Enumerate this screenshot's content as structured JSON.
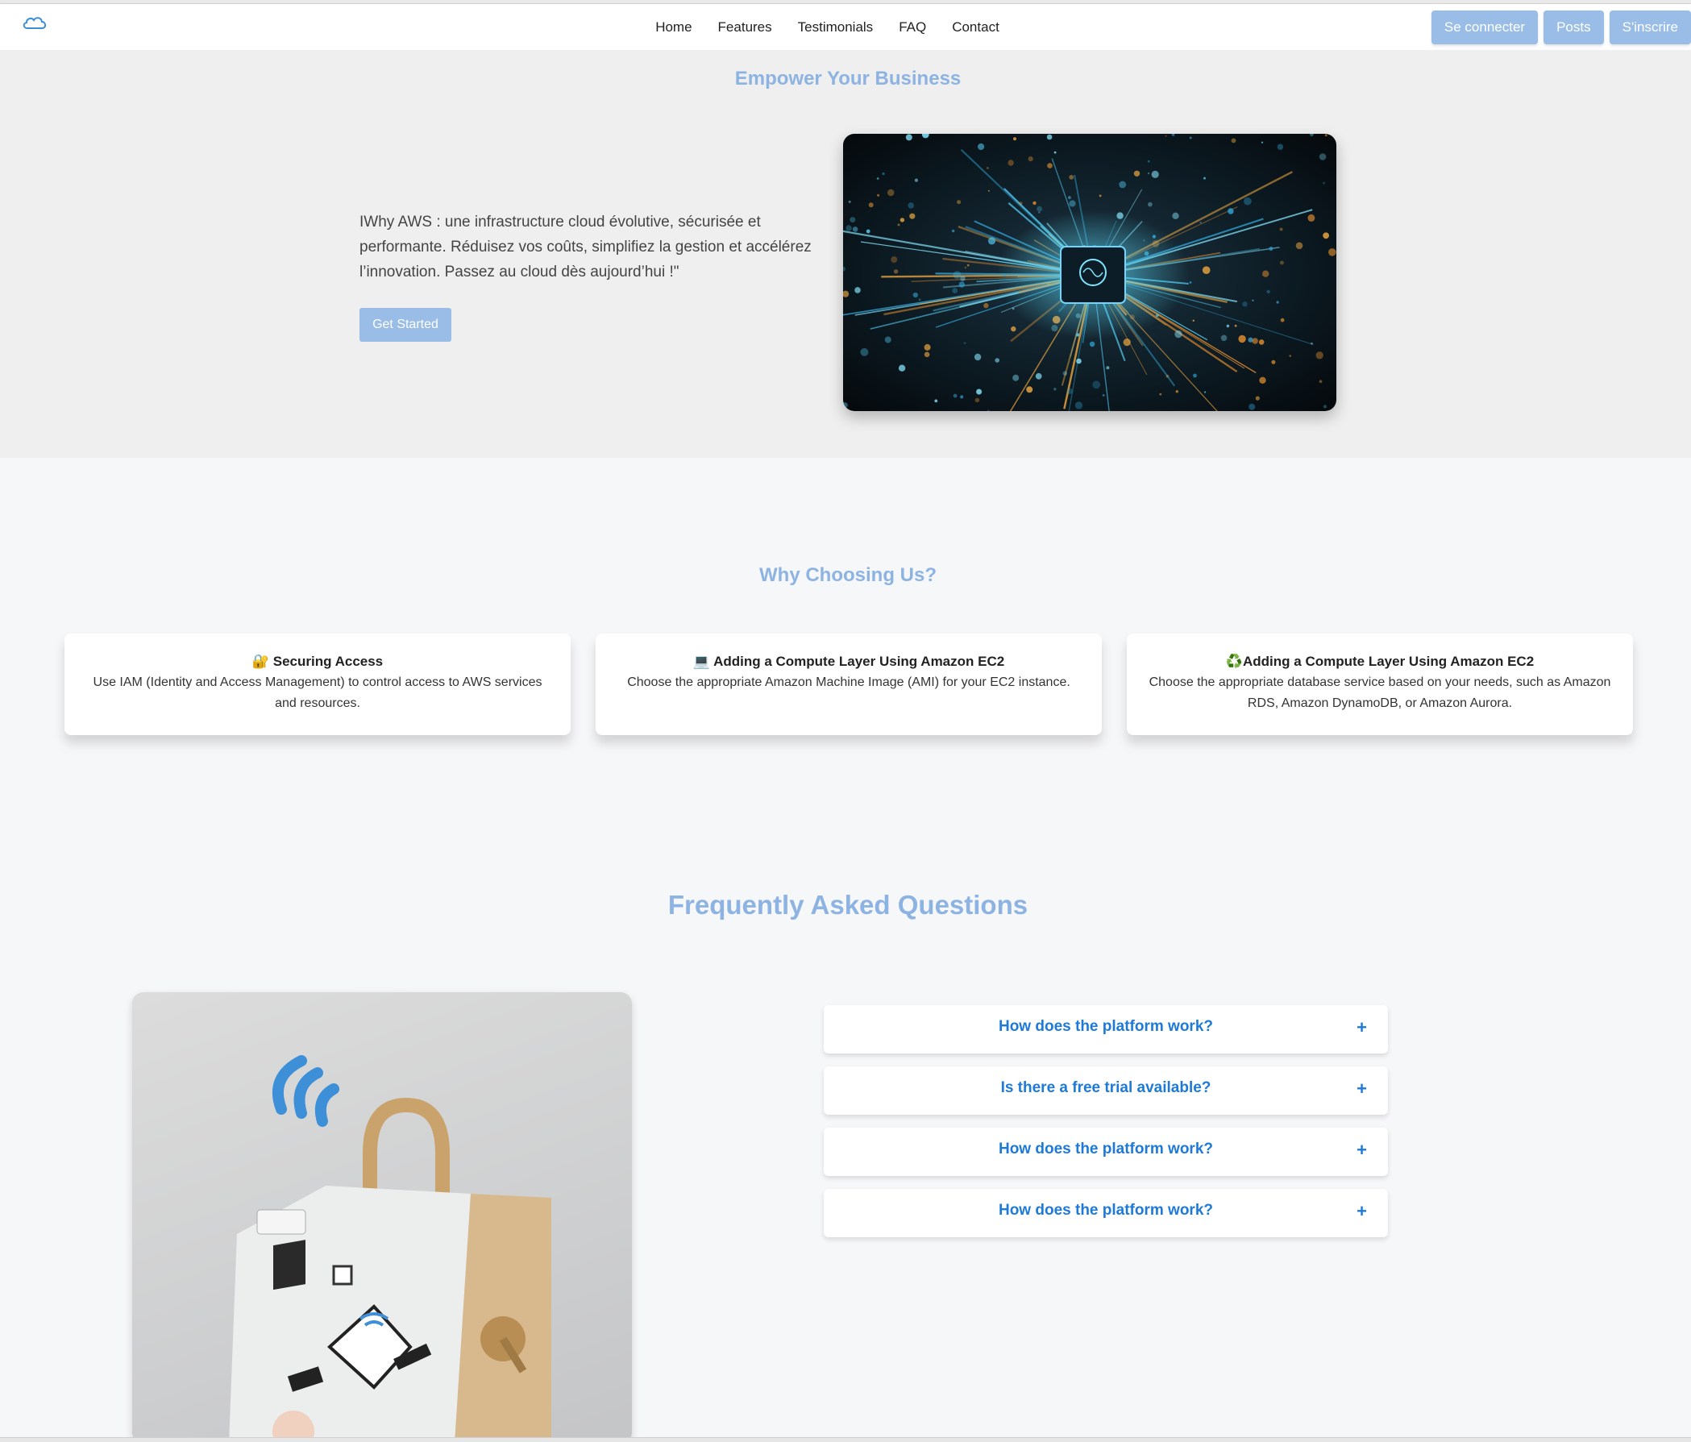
{
  "header": {
    "logo": "cloud-icon",
    "nav": [
      "Home",
      "Features",
      "Testimonials",
      "FAQ",
      "Contact"
    ],
    "buttons": {
      "login": "Se connecter",
      "posts": "Posts",
      "signup": "S'inscrire"
    }
  },
  "hero": {
    "title": "Empower Your Business",
    "text": "IWhy AWS : une infrastructure cloud évolutive, sécurisée et performante. Réduisez vos coûts, simplifiez la gestion et accélérez l’innovation. Passez au cloud dès aujourd’hui !\"",
    "cta": "Get Started",
    "image": "circuit-board-image"
  },
  "why": {
    "title": "Why Choosing Us?",
    "cards": [
      {
        "icon": "🔐",
        "title": "Securing Access",
        "desc": "Use IAM (Identity and Access Management) to control access to AWS services and resources."
      },
      {
        "icon": "💻",
        "title": "Adding a Compute Layer Using Amazon EC2",
        "desc": "Choose the appropriate Amazon Machine Image (AMI) for your EC2 instance."
      },
      {
        "icon": "♻️",
        "title": "Adding a Compute Layer Using Amazon EC2",
        "desc": "Choose the appropriate database service based on your needs, such as Amazon RDS, Amazon DynamoDB, or Amazon Aurora."
      }
    ]
  },
  "faq": {
    "title": "Frequently Asked Questions",
    "image": "smart-home-lock-image",
    "items": [
      {
        "q": "How does the platform work?",
        "icon": "+"
      },
      {
        "q": "Is there a free trial available?",
        "icon": "+"
      },
      {
        "q": "How does the platform work?",
        "icon": "+"
      },
      {
        "q": "How does the platform work?",
        "icon": "+"
      }
    ]
  }
}
